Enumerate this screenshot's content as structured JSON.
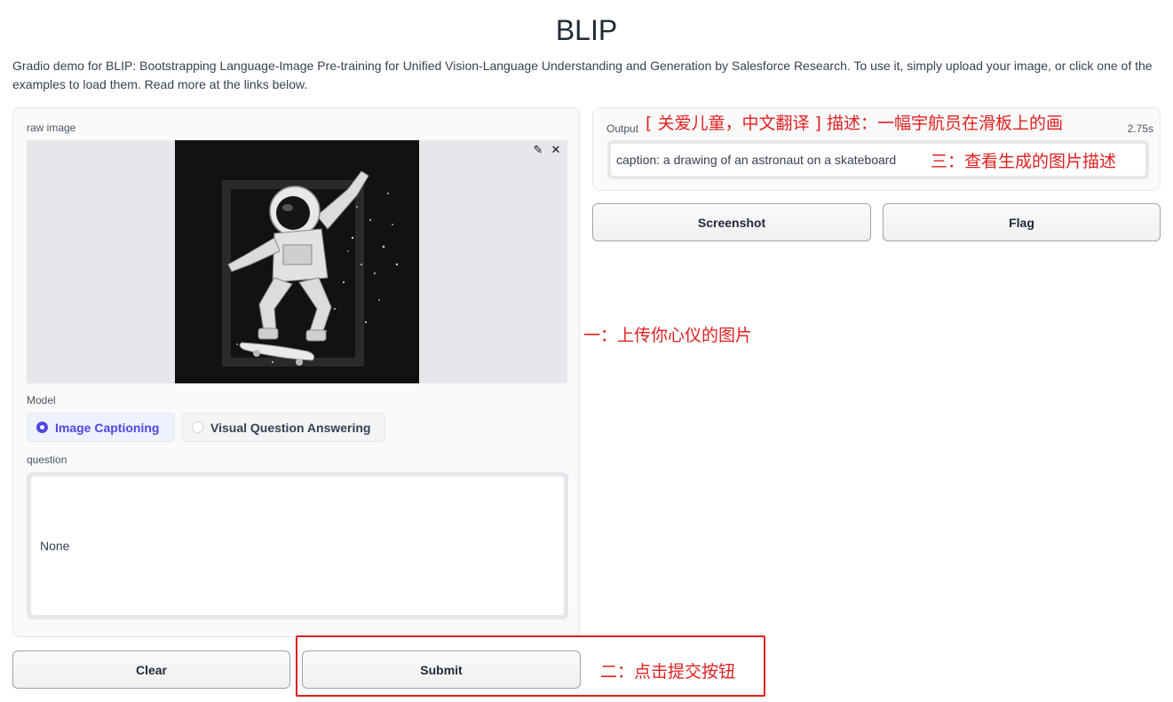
{
  "header": {
    "title": "BLIP",
    "description": "Gradio demo for BLIP: Bootstrapping Language-Image Pre-training for Unified Vision-Language Understanding and Generation by Salesforce Research. To use it, simply upload your image, or click one of the examples to load them. Read more at the links below."
  },
  "input": {
    "image_label": "raw image",
    "image_tools": {
      "edit_icon": "pencil-icon",
      "clear_icon": "close-icon"
    },
    "model_label": "Model",
    "model_options": [
      "Image Captioning",
      "Visual Question Answering"
    ],
    "model_selected": "Image Captioning",
    "question_label": "question",
    "question_value": "None"
  },
  "output": {
    "label": "Output",
    "time": "2.75s",
    "value": "caption: a drawing of an astronaut on a skateboard"
  },
  "buttons": {
    "screenshot": "Screenshot",
    "flag": "Flag",
    "clear": "Clear",
    "submit": "Submit"
  },
  "annotations": {
    "step1": "一：上传你心仪的图片",
    "step2": "二：点击提交按钮",
    "step3": "三：查看生成的图片描述",
    "caption_translation": "[ 关爱儿童，中文翻译 ] 描述：一幅宇航员在滑板上的画",
    "color": "#e02020"
  }
}
